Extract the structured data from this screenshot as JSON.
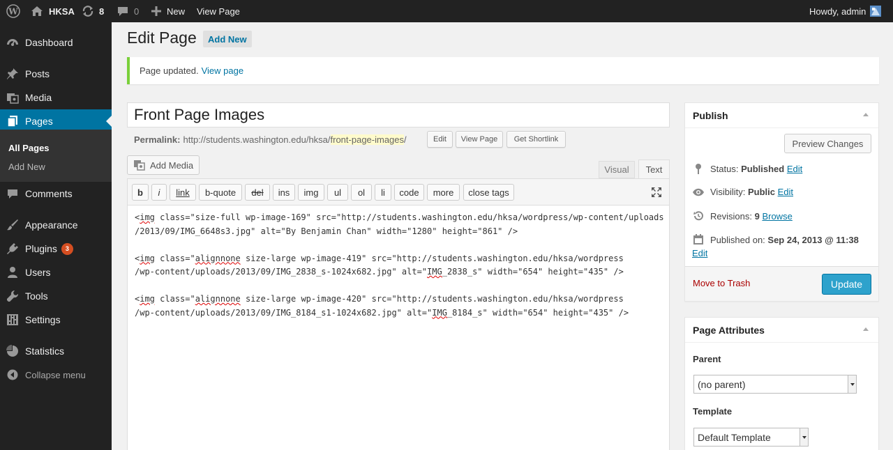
{
  "adminbar": {
    "site_name": "HKSA",
    "updates_count": "8",
    "comments_count": "0",
    "new_label": "New",
    "view_page_label": "View Page",
    "howdy": "Howdy, admin"
  },
  "sidebar": {
    "items": [
      {
        "label": "Dashboard",
        "icon": "dashboard-icon"
      },
      {
        "label": "Posts",
        "icon": "pin-icon"
      },
      {
        "label": "Media",
        "icon": "media-icon"
      },
      {
        "label": "Pages",
        "icon": "pages-icon"
      },
      {
        "label": "Comments",
        "icon": "comment-icon"
      },
      {
        "label": "Appearance",
        "icon": "brush-icon"
      },
      {
        "label": "Plugins",
        "icon": "plugin-icon",
        "badge": "3"
      },
      {
        "label": "Users",
        "icon": "users-icon"
      },
      {
        "label": "Tools",
        "icon": "wrench-icon"
      },
      {
        "label": "Settings",
        "icon": "settings-icon"
      },
      {
        "label": "Statistics",
        "icon": "chart-icon"
      }
    ],
    "submenu": [
      "All Pages",
      "Add New"
    ],
    "collapse_label": "Collapse menu"
  },
  "main": {
    "title": "Edit Page",
    "add_new_label": "Add New",
    "notice_text": "Page updated.",
    "notice_link": "View page",
    "post_title": "Front Page Images",
    "permalink_label": "Permalink:",
    "permalink_base": "http://students.washington.edu/hksa/",
    "permalink_slug": "front-page-images",
    "permalink_trail": "/",
    "edit_btn": "Edit",
    "view_page_btn": "View Page",
    "shortlink_btn": "Get Shortlink",
    "add_media_label": "Add Media",
    "tab_visual": "Visual",
    "tab_text": "Text"
  },
  "quicktags": [
    "b",
    "i",
    "link",
    "b-quote",
    "del",
    "ins",
    "img",
    "ul",
    "ol",
    "li",
    "code",
    "more",
    "close tags"
  ],
  "code": {
    "l1a": "<",
    "l1b": "img",
    "l1c": " class=\"size-full wp-image-169\" src=\"http://students.washington.edu/hksa/wordpress/wp-content/uploads",
    "l2": "/2013/09/IMG_6648s3.jpg\" alt=\"By Benjamin Chan\" width=\"1280\" height=\"861\" />",
    "l3a": "<",
    "l3b": "img",
    "l3c": " class=\"",
    "l3d": "alignnone",
    "l3e": " size-large wp-image-419\" src=\"http://students.washington.edu/hksa/wordpress",
    "l4a": "/wp-content/uploads/2013/09/IMG_2838_s-1024x682.jpg\" alt=\"",
    "l4b": "IMG",
    "l4c": "_2838_s\" width=\"654\" height=\"435\" />",
    "l5a": "<",
    "l5b": "img",
    "l5c": " class=\"",
    "l5d": "alignnone",
    "l5e": " size-large wp-image-420\" src=\"http://students.washington.edu/hksa/wordpress",
    "l6a": "/wp-content/uploads/2013/09/IMG_8184_s1-1024x682.jpg\" alt=\"",
    "l6b": "IMG",
    "l6c": "_8184_s\" width=\"654\" height=\"435\" />"
  },
  "publish": {
    "title": "Publish",
    "preview_btn": "Preview Changes",
    "status_label": "Status:",
    "status_value": "Published",
    "visibility_label": "Visibility:",
    "visibility_value": "Public",
    "revisions_label": "Revisions:",
    "revisions_value": "9",
    "browse_link": "Browse",
    "published_label": "Published on:",
    "published_value": "Sep 24, 2013 @ 11:38",
    "edit_link": "Edit",
    "trash_link": "Move to Trash",
    "update_btn": "Update"
  },
  "attributes": {
    "title": "Page Attributes",
    "parent_label": "Parent",
    "parent_value": "(no parent)",
    "template_label": "Template",
    "template_value": "Default Template"
  }
}
